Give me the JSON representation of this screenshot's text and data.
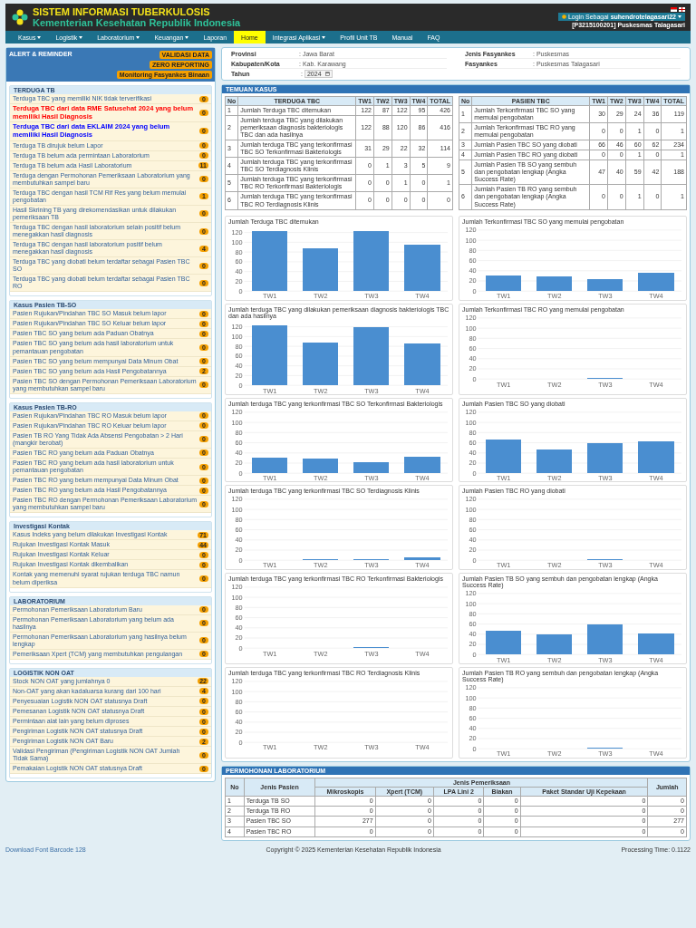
{
  "header": {
    "title": "SISTEM INFORMASI TUBERKULOSIS",
    "subtitle": "Kementerian Kesehatan Republik Indonesia",
    "login": "Login Sebagai **suhendrotelagasari22**",
    "facility": "[P3215100201] Puskesmas Talagasari"
  },
  "nav": [
    {
      "label": "Kasus",
      "has_menu": true,
      "selected": false
    },
    {
      "label": "Logistik",
      "has_menu": true,
      "selected": false
    },
    {
      "label": "Laboratorium",
      "has_menu": true,
      "selected": false
    },
    {
      "label": "Keuangan",
      "has_menu": true,
      "selected": false
    },
    {
      "label": "Laporan",
      "has_menu": false,
      "selected": false
    },
    {
      "label": "Home",
      "has_menu": false,
      "selected": true
    },
    {
      "label": "Integrasi Aplikasi",
      "has_menu": true,
      "selected": false
    },
    {
      "label": "Profil Unit TB",
      "has_menu": false,
      "selected": false
    },
    {
      "label": "Manual",
      "has_menu": false,
      "selected": false
    },
    {
      "label": "FAQ",
      "has_menu": false,
      "selected": false
    }
  ],
  "sidebar": {
    "title": "ALERT & REMINDER",
    "buttons": [
      "VALIDASI DATA",
      "ZERO REPORTING",
      "Monitoring Fasyankes Binaan"
    ],
    "sections": [
      {
        "title": "TERDUGA TB",
        "items": [
          {
            "label": "Terduga TBC yang memiliki NIK tidak terverifikasi",
            "count": "0",
            "kind": "normal"
          },
          {
            "label": "Terduga TBC dari data RME Satusehat 2024 yang belum memiliki Hasil Diagnosis",
            "count": "0",
            "kind": "highlight",
            "color": "#ff0000"
          },
          {
            "label": "Terduga TBC dari data EKLAIM 2024 yang belum memiliki Hasil Diagnosis",
            "count": "0",
            "kind": "highlight",
            "color": "#0000ff"
          },
          {
            "label": "Terduga TB dirujuk belum Lapor",
            "count": "0",
            "kind": "normal"
          },
          {
            "label": "Terduga TB belum ada permintaan Laboratorium",
            "count": "0",
            "kind": "normal"
          },
          {
            "label": "Terduga TB belum ada Hasil Laboratorium",
            "count": "11",
            "kind": "normal"
          },
          {
            "label": "Terduga dengan Permohonan Pemeriksaan Laboratorium yang membutuhkan sampel baru",
            "count": "0",
            "kind": "normal"
          },
          {
            "label": "Terduga TBC dengan hasil TCM Rif Res yang belum memulai pengobatan",
            "count": "1",
            "kind": "normal"
          },
          {
            "label": "Hasil Skrining TB yang direkomendasikan untuk dilakukan pemeriksaan TB",
            "count": "0",
            "kind": "normal"
          },
          {
            "label": "Terduga TBC dengan hasil laboratorium selain positif belum menegakkan hasil diagnosis",
            "count": "0",
            "kind": "normal"
          },
          {
            "label": "Terduga TBC dengan hasil laboratorium positif belum menegakkan hasil diagnosis",
            "count": "4",
            "kind": "normal"
          },
          {
            "label": "Terduga TBC yang diobati belum terdaftar sebagai Pasien TBC SO",
            "count": "0",
            "kind": "normal"
          },
          {
            "label": "Terduga TBC yang diobati belum terdaftar sebagai Pasien TBC RO",
            "count": "0",
            "kind": "normal"
          }
        ]
      },
      {
        "title": "Kasus Pasien TB-SO",
        "items": [
          {
            "label": "Pasien Rujukan/Pindahan TBC SO Masuk belum lapor",
            "count": "0",
            "kind": "normal"
          },
          {
            "label": "Pasien Rujukan/Pindahan TBC SO Keluar belum lapor",
            "count": "0",
            "kind": "normal"
          },
          {
            "label": "Pasien TBC SO yang belum ada Paduan Obatnya",
            "count": "0",
            "kind": "normal"
          },
          {
            "label": "Pasien TBC SO yang belum ada hasil laboratorium untuk pemantauan pengobatan",
            "count": "0",
            "kind": "normal"
          },
          {
            "label": "Pasien TBC SO yang belum mempunyai Data Minum Obat",
            "count": "0",
            "kind": "normal"
          },
          {
            "label": "Pasien TBC SO yang belum ada Hasil Pengobatannya",
            "count": "2",
            "kind": "normal"
          },
          {
            "label": "Pasien TBC SO dengan Permohonan Pemeriksaan Laboratorium yang membutuhkan sampel baru",
            "count": "0",
            "kind": "normal"
          }
        ]
      },
      {
        "title": "Kasus Pasien TB-RO",
        "items": [
          {
            "label": "Pasien Rujukan/Pindahan TBC RO Masuk belum lapor",
            "count": "0",
            "kind": "normal"
          },
          {
            "label": "Pasien Rujukan/Pindahan TBC RO Keluar belum lapor",
            "count": "0",
            "kind": "normal"
          },
          {
            "label": "Pasien TB RO Yang Tidak Ada Absensi Pengobatan > 2 Hari (mangkir berobat)",
            "count": "0",
            "kind": "normal"
          },
          {
            "label": "Pasien TBC RO yang belum ada Paduan Obatnya",
            "count": "0",
            "kind": "normal"
          },
          {
            "label": "Pasien TBC RO yang belum ada hasil laboratorium untuk pemantauan pengobatan",
            "count": "0",
            "kind": "normal"
          },
          {
            "label": "Pasien TBC RO yang belum mempunyai Data Minum Obat",
            "count": "0",
            "kind": "normal"
          },
          {
            "label": "Pasien TBC RO yang belum ada Hasil Pengobatannya",
            "count": "0",
            "kind": "normal"
          },
          {
            "label": "Pasien TBC RO dengan Permohonan Pemeriksaan Laboratorium yang membutuhkan sampel baru",
            "count": "0",
            "kind": "normal"
          }
        ]
      },
      {
        "title": "Investigasi Kontak",
        "items": [
          {
            "label": "Kasus Indeks yang belum dilakukan Investigasi Kontak",
            "count": "71",
            "kind": "normal"
          },
          {
            "label": "Rujukan Investigasi Kontak Masuk",
            "count": "44",
            "kind": "normal"
          },
          {
            "label": "Rujukan Investigasi Kontak Keluar",
            "count": "0",
            "kind": "normal"
          },
          {
            "label": "Rujukan Investigasi Kontak dikembalikan",
            "count": "0",
            "kind": "normal"
          },
          {
            "label": "Kontak yang memenuhi syarat rujukan terduga TBC namun belum diperiksa",
            "count": "0",
            "kind": "normal"
          }
        ]
      },
      {
        "title": "LABORATORIUM",
        "items": [
          {
            "label": "Permohonan Pemeriksaan Laboratorium Baru",
            "count": "0",
            "kind": "normal"
          },
          {
            "label": "Permohonan Pemeriksaan Laboratorium yang belum ada hasilnya",
            "count": "0",
            "kind": "normal"
          },
          {
            "label": "Permohonan Pemeriksaan Laboratorium yang hasilnya belum lengkap",
            "count": "0",
            "kind": "normal"
          },
          {
            "label": "Pemeriksaan Xpert (TCM) yang membutuhkan pengulangan",
            "count": "0",
            "kind": "normal"
          }
        ]
      },
      {
        "title": "LOGISTIK NON OAT",
        "items": [
          {
            "label": "Stock NON OAT yang jumlahnya 0",
            "count": "22",
            "kind": "normal"
          },
          {
            "label": "Non-OAT yang akan kadaluarsa kurang dari 100 hari",
            "count": "4",
            "kind": "normal"
          },
          {
            "label": "Penyesuaian Logistik NON OAT statusnya Draft",
            "count": "0",
            "kind": "normal"
          },
          {
            "label": "Pemesanan Logistik NON OAT statusnya Draft",
            "count": "0",
            "kind": "normal"
          },
          {
            "label": "Permintaan alat lain yang belum diproses",
            "count": "0",
            "kind": "normal"
          },
          {
            "label": "Pengiriman Logistik NON OAT statusnya Draft",
            "count": "0",
            "kind": "normal"
          },
          {
            "label": "Pengiriman Logistik NON OAT Baru",
            "count": "2",
            "kind": "normal"
          },
          {
            "label": "Validasi Pengiriman (Pengiriman Logistik NON OAT Jumlah Tidak Sama)",
            "count": "0",
            "kind": "normal"
          },
          {
            "label": "Pemakaian Logistik NON OAT statusnya Draft",
            "count": "0",
            "kind": "normal"
          }
        ]
      }
    ]
  },
  "filters": [
    {
      "label": "Provinsi",
      "value": ": Jawa Barat"
    },
    {
      "label": "Jenis Fasyankes",
      "value": ": Puskesmas"
    },
    {
      "label": "Kabupaten/Kota",
      "value": ": Kab. Karawang"
    },
    {
      "label": "Fasyankes",
      "value": ": Puskesmas Talagasari"
    }
  ],
  "year": {
    "label": "Tahun",
    "separator": ":",
    "value": "2024"
  },
  "temuan": {
    "title": "TEMUAN KASUS",
    "tables": [
      {
        "columns": [
          "No",
          "TERDUGA TBC",
          "TW1",
          "TW2",
          "TW3",
          "TW4",
          "TOTAL"
        ],
        "rows": [
          [
            "1",
            "Jumlah Terduga TBC ditemukan",
            "122",
            "87",
            "122",
            "95",
            "426"
          ],
          [
            "2",
            "Jumlah terduga TBC yang dilakukan pemeriksaan diagnosis bakteriologis TBC dan ada hasilnya",
            "122",
            "88",
            "120",
            "86",
            "416"
          ],
          [
            "3",
            "Jumlah terduga TBC yang terkonfirmasi TBC SO Terkonfirmasi Bakteriologis",
            "31",
            "29",
            "22",
            "32",
            "114"
          ],
          [
            "4",
            "Jumlah terduga TBC yang terkonfirmasi TBC SO Terdiagnosis Klinis",
            "0",
            "1",
            "3",
            "5",
            "9"
          ],
          [
            "5",
            "Jumlah terduga TBC yang terkonfirmasi TBC RO Terkonfirmasi Bakteriologis",
            "0",
            "0",
            "1",
            "0",
            "1"
          ],
          [
            "6",
            "Jumlah terduga TBC yang terkonfirmasi TBC RO Terdiagnosis Klinis",
            "0",
            "0",
            "0",
            "0",
            "0"
          ]
        ]
      },
      {
        "columns": [
          "No",
          "PASIEN TBC",
          "TW1",
          "TW2",
          "TW3",
          "TW4",
          "TOTAL"
        ],
        "rows": [
          [
            "1",
            "Jumlah Terkonfirmasi TBC SO yang memulai pengobatan",
            "30",
            "29",
            "24",
            "36",
            "119"
          ],
          [
            "2",
            "Jumlah Terkonfirmasi TBC RO yang memulai pengobatan",
            "0",
            "0",
            "1",
            "0",
            "1"
          ],
          [
            "3",
            "Jumlah Pasien TBC SO yang diobati",
            "66",
            "46",
            "60",
            "62",
            "234"
          ],
          [
            "4",
            "Jumlah Pasien TBC RO yang diobati",
            "0",
            "0",
            "1",
            "0",
            "1"
          ],
          [
            "5",
            "Jumlah Pasien TB SO yang sembuh dan pengobatan lengkap (Angka Success Rate)",
            "47",
            "40",
            "59",
            "42",
            "188"
          ],
          [
            "6",
            "Jumlah Pasien TB RO yang sembuh dan pengobatan lengkap (Angka Success Rate)",
            "0",
            "0",
            "1",
            "0",
            "1"
          ]
        ]
      }
    ],
    "charts": [
      {
        "chart_data": {
          "type": "bar",
          "title": "Jumlah Terduga TBC ditemukan",
          "categories": [
            "TW1",
            "TW2",
            "TW3",
            "TW4"
          ],
          "values": [
            122,
            87,
            122,
            95
          ],
          "ylim": [
            0,
            125
          ],
          "yticks": [
            0,
            20,
            40,
            60,
            80,
            100,
            120
          ],
          "grid": true
        }
      },
      {
        "chart_data": {
          "type": "bar",
          "title": "Jumlah Terkonfirmasi TBC SO yang memulai pengobatan",
          "categories": [
            "TW1",
            "TW2",
            "TW3",
            "TW4"
          ],
          "values": [
            30,
            29,
            24,
            36
          ],
          "ylim": [
            0,
            120
          ],
          "yticks": [
            0,
            20,
            40,
            60,
            80,
            100,
            120
          ],
          "grid": true
        }
      },
      {
        "chart_data": {
          "type": "bar",
          "title": "Jumlah terduga TBC yang dilakukan pemeriksaan diagnosis bakteriologis TBC dan ada hasilnya",
          "categories": [
            "TW1",
            "TW2",
            "TW3",
            "TW4"
          ],
          "values": [
            122,
            88,
            120,
            86
          ],
          "ylim": [
            0,
            125
          ],
          "yticks": [
            0,
            20,
            40,
            60,
            80,
            100,
            120
          ],
          "grid": true
        }
      },
      {
        "chart_data": {
          "type": "bar",
          "title": "Jumlah Terkonfirmasi TBC RO yang memulai pengobatan",
          "categories": [
            "TW1",
            "TW2",
            "TW3",
            "TW4"
          ],
          "values": [
            0,
            0,
            1,
            0
          ],
          "ylim": [
            0,
            120
          ],
          "yticks": [
            0,
            20,
            40,
            60,
            80,
            100,
            120
          ],
          "grid": true
        }
      },
      {
        "chart_data": {
          "type": "bar",
          "title": "Jumlah terduga TBC yang terkonfirmasi TBC SO Terkonfirmasi Bakteriologis",
          "categories": [
            "TW1",
            "TW2",
            "TW3",
            "TW4"
          ],
          "values": [
            31,
            29,
            22,
            32
          ],
          "ylim": [
            0,
            120
          ],
          "yticks": [
            0,
            20,
            40,
            60,
            80,
            100,
            120
          ],
          "grid": true
        }
      },
      {
        "chart_data": {
          "type": "bar",
          "title": "Jumlah Pasien TBC SO yang diobati",
          "categories": [
            "TW1",
            "TW2",
            "TW3",
            "TW4"
          ],
          "values": [
            66,
            46,
            60,
            62
          ],
          "ylim": [
            0,
            120
          ],
          "yticks": [
            0,
            20,
            40,
            60,
            80,
            100,
            120
          ],
          "grid": true
        }
      },
      {
        "chart_data": {
          "type": "bar",
          "title": "Jumlah terduga TBC yang terkonfirmasi TBC SO Terdiagnosis Klinis",
          "categories": [
            "TW1",
            "TW2",
            "TW3",
            "TW4"
          ],
          "values": [
            0,
            1,
            3,
            5
          ],
          "ylim": [
            0,
            120
          ],
          "yticks": [
            0,
            20,
            40,
            60,
            80,
            100,
            120
          ],
          "grid": true
        }
      },
      {
        "chart_data": {
          "type": "bar",
          "title": "Jumlah Pasien TBC RO yang diobati",
          "categories": [
            "TW1",
            "TW2",
            "TW3",
            "TW4"
          ],
          "values": [
            0,
            0,
            1,
            0
          ],
          "ylim": [
            0,
            120
          ],
          "yticks": [
            0,
            20,
            40,
            60,
            80,
            100,
            120
          ],
          "grid": true
        }
      },
      {
        "chart_data": {
          "type": "bar",
          "title": "Jumlah terduga TBC yang terkonfirmasi TBC RO Terkonfirmasi Bakteriologis",
          "categories": [
            "TW1",
            "TW2",
            "TW3",
            "TW4"
          ],
          "values": [
            0,
            0,
            1,
            0
          ],
          "ylim": [
            0,
            120
          ],
          "yticks": [
            0,
            20,
            40,
            60,
            80,
            100,
            120
          ],
          "grid": true
        }
      },
      {
        "chart_data": {
          "type": "bar",
          "title": "Jumlah Pasien TB SO yang sembuh dan pengobatan lengkap (Angka Success Rate)",
          "categories": [
            "TW1",
            "TW2",
            "TW3",
            "TW4"
          ],
          "values": [
            47,
            40,
            59,
            42
          ],
          "ylim": [
            0,
            120
          ],
          "yticks": [
            0,
            20,
            40,
            60,
            80,
            100,
            120
          ],
          "grid": true
        }
      },
      {
        "chart_data": {
          "type": "bar",
          "title": "Jumlah terduga TBC yang terkonfirmasi TBC RO Terdiagnosis Klinis",
          "categories": [
            "TW1",
            "TW2",
            "TW3",
            "TW4"
          ],
          "values": [
            0,
            0,
            0,
            0
          ],
          "ylim": [
            0,
            120
          ],
          "yticks": [
            0,
            20,
            40,
            60,
            80,
            100,
            120
          ],
          "grid": true
        }
      },
      {
        "chart_data": {
          "type": "bar",
          "title": "Jumlah Pasien TB RO yang sembuh dan pengobatan lengkap (Angka Success Rate)",
          "categories": [
            "TW1",
            "TW2",
            "TW3",
            "TW4"
          ],
          "values": [
            0,
            0,
            1,
            0
          ],
          "ylim": [
            0,
            120
          ],
          "yticks": [
            0,
            20,
            40,
            60,
            80,
            100,
            120
          ],
          "grid": true
        }
      }
    ]
  },
  "lab": {
    "title": "PERMOHONAN LABORATORIUM",
    "col_no": "No",
    "col_patient": "Jenis Pasien",
    "group": "Jenis Pemeriksaan",
    "sub_columns": [
      "Mikroskopis",
      "Xpert (TCM)",
      "LPA Lini 2",
      "Biakan",
      "Paket Standar Uji Kepekaan"
    ],
    "col_total": "Jumlah",
    "rows": [
      [
        "1",
        "Terduga TB SO",
        "0",
        "0",
        "0",
        "0",
        "0",
        "0"
      ],
      [
        "2",
        "Terduga TB RO",
        "0",
        "0",
        "0",
        "0",
        "0",
        "0"
      ],
      [
        "3",
        "Pasien TBC SO",
        "277",
        "0",
        "0",
        "0",
        "0",
        "277"
      ],
      [
        "4",
        "Pasien TBC RO",
        "0",
        "0",
        "0",
        "0",
        "0",
        "0"
      ]
    ]
  },
  "footer": {
    "link": "Download Font Barcode 128",
    "copyright": "Copyright © 2025 Kementerian Kesehatan Republik Indonesia",
    "time": "Processing Time: 0.1122"
  }
}
